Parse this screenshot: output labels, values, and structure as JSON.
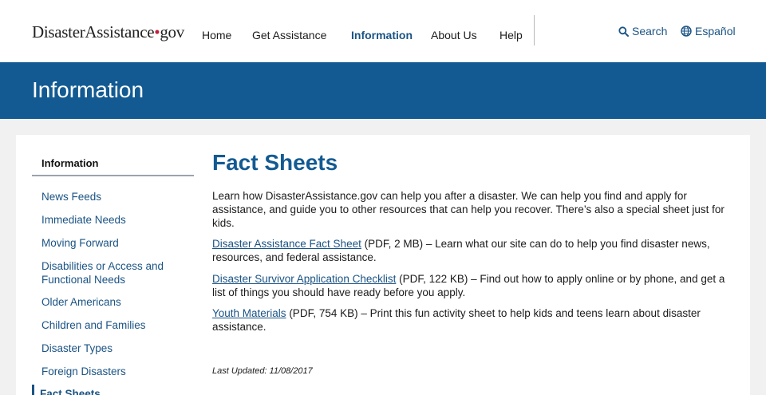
{
  "header": {
    "logo": {
      "part1": "Disaster",
      "part2": "Assistance",
      "dot": "•",
      "part3": "gov"
    },
    "nav": [
      {
        "label": "Home"
      },
      {
        "label": "Get Assistance"
      },
      {
        "label": "Information",
        "active": true
      },
      {
        "label": "About Us"
      },
      {
        "label": "Help"
      }
    ],
    "search_label": "Search",
    "language_label": "Español",
    "icons": {
      "search": "search-icon",
      "language": "globe-icon"
    }
  },
  "banner": {
    "title": "Information"
  },
  "sidebar": {
    "heading": "Information",
    "items": [
      {
        "label": "News Feeds"
      },
      {
        "label": "Immediate Needs"
      },
      {
        "label": "Moving Forward"
      },
      {
        "label": "Disabilities or Access and Functional Needs"
      },
      {
        "label": "Older Americans"
      },
      {
        "label": "Children and Families"
      },
      {
        "label": "Disaster Types"
      },
      {
        "label": "Foreign Disasters"
      },
      {
        "label": "Fact Sheets",
        "current": true
      }
    ]
  },
  "main": {
    "title": "Fact Sheets",
    "intro": "Learn how DisasterAssistance.gov can help you after a disaster. We can help you find and apply for assistance, and guide you to other resources that can help you recover. There’s also a special sheet just for kids.",
    "resources": [
      {
        "link": "Disaster Assistance Fact Sheet",
        "meta": " (PDF, 2 MB)",
        "description": " – Learn what our site can do to help you find disaster news, resources, and federal assistance."
      },
      {
        "link": "Disaster Survivor Application Checklist",
        "meta": " (PDF, 122 KB)",
        "description": " – Find out how to apply online or by phone, and get a list of things you should have ready before you apply."
      },
      {
        "link": "Youth Materials",
        "meta": " (PDF, 754 KB)",
        "description": " – Print this fun activity sheet to help kids and teens learn about disaster assistance."
      }
    ],
    "last_updated": "Last Updated: 11/08/2017"
  },
  "colors": {
    "primary": "#135a92",
    "link": "#1a5384",
    "logo_dot": "#c41e3a",
    "page_background": "#f1f1f1"
  }
}
